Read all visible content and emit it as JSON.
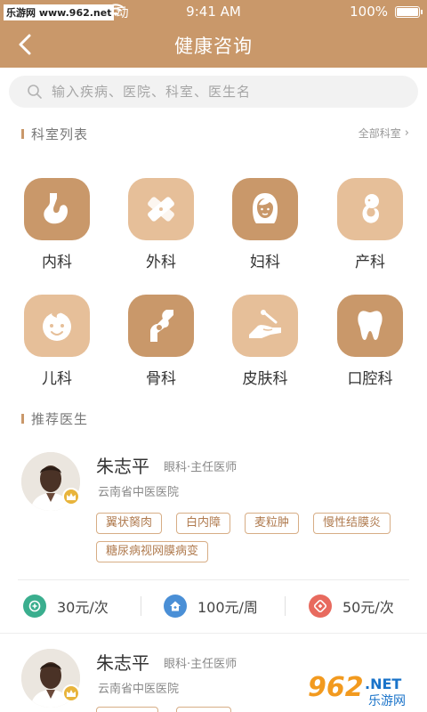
{
  "status": {
    "watermark": "乐游网 www.962.net",
    "carrier_tail": "动",
    "time": "9:41 AM",
    "battery": "100%"
  },
  "nav": {
    "title": "健康咨询"
  },
  "search": {
    "placeholder": "输入疾病、医院、科室、医生名"
  },
  "departments": {
    "title": "科室列表",
    "all_link": "全部科室",
    "items": [
      {
        "label": "内科",
        "icon": "stomach-icon"
      },
      {
        "label": "外科",
        "icon": "bandage-icon"
      },
      {
        "label": "妇科",
        "icon": "woman-icon"
      },
      {
        "label": "产科",
        "icon": "fetus-icon"
      },
      {
        "label": "儿科",
        "icon": "baby-icon"
      },
      {
        "label": "骨科",
        "icon": "bone-joint-icon"
      },
      {
        "label": "皮肤科",
        "icon": "skin-hand-icon"
      },
      {
        "label": "口腔科",
        "icon": "tooth-icon"
      }
    ]
  },
  "recommended": {
    "title": "推荐医生",
    "doctors": [
      {
        "name": "朱志平",
        "title": "眼科·主任医师",
        "hospital": "云南省中医医院",
        "tags": [
          "翼状胬肉",
          "白内障",
          "麦粒肿",
          "慢性结膜炎",
          "糖尿病视网膜病变"
        ],
        "prices": [
          {
            "text": "30元/次",
            "icon": "chat-icon",
            "color": "#3aae8e"
          },
          {
            "text": "100元/周",
            "icon": "home-icon",
            "color": "#4a8fd6"
          },
          {
            "text": "50元/次",
            "icon": "phone-icon",
            "color": "#e86a5e"
          }
        ]
      },
      {
        "name": "朱志平",
        "title": "眼科·主任医师",
        "hospital": "云南省中医医院"
      }
    ]
  },
  "colors": {
    "accent": "#c9986a",
    "accent_light": "#e6bf99",
    "tag": "#b07b4f"
  },
  "logo": {
    "digits": "962",
    "suffix": ".NET",
    "sub": "乐游网"
  }
}
